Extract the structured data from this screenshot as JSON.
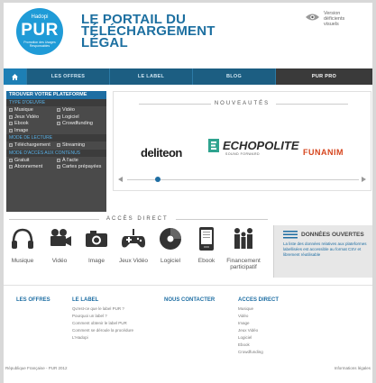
{
  "header": {
    "logo_small": "Hadopi",
    "logo_brand": "PUR",
    "logo_tagline": "Promotion des Usages Responsables",
    "title_line1": "LE PORTAIL DU",
    "title_line2": "TÉLÉCHARGEMENT",
    "title_line3": "LÉGAL",
    "accessibility_label": "Version déficients visuels"
  },
  "nav": {
    "items": [
      {
        "label": "LES OFFRES"
      },
      {
        "label": "LE LABEL"
      },
      {
        "label": "BLOG"
      },
      {
        "label": "PUR PRO"
      }
    ]
  },
  "platform_panel": {
    "title": "TROUVER VOTRE PLATEFORME",
    "section1": "TYPE D'OEUVRE",
    "types": [
      "Musique",
      "Vidéo",
      "Jeux Vidéo",
      "Logiciel",
      "Ebook",
      "Crowdfunding",
      "Image"
    ],
    "section2": "MODE DE LECTURE",
    "modes": [
      "Téléchargement",
      "Streaming"
    ],
    "section3": "MODE D'ACCÈS AUX CONTENUS",
    "access": [
      "Gratuit",
      "À l'acte",
      "Abonnement",
      "Cartes prépayées"
    ]
  },
  "news": {
    "title": "NOUVEAUTÉS",
    "partners": [
      "deliteon",
      "ECHOPOLITE",
      "FUNANIM"
    ],
    "echopolite_sub": "SOUND FORWARD"
  },
  "direct_access": {
    "title": "ACCÈS DIRECT",
    "tiles": [
      "Musique",
      "Vidéo",
      "Image",
      "Jeux Vidéo",
      "Logiciel",
      "Ebook",
      "Financement participatif"
    ]
  },
  "open_data": {
    "title": "DONNÉES OUVERTES",
    "text": "La liste des données relatives aux plateformes labellisées est accessible au format CSV et librement réutilisable"
  },
  "footer": {
    "col1": {
      "head": "LES OFFRES"
    },
    "col2": {
      "head": "LE LABEL",
      "links": [
        "Qu'est-ce que le label PUR ?",
        "Pourquoi un label ?",
        "Comment obtenir le label PUR",
        "Comment se déroule la procédure",
        "L'Hadopi"
      ]
    },
    "col3": {
      "head": "NOUS CONTACTER"
    },
    "col4": {
      "head": "ACCES DIRECT",
      "links": [
        "Musique",
        "Vidéo",
        "Image",
        "Jeux Vidéo",
        "Logiciel",
        "Ebook",
        "Crowdfunding"
      ]
    },
    "copyright": "République Française - PUR 2012",
    "legal": "Informations légales"
  },
  "colors": {
    "brand_blue": "#1f9bd7",
    "nav_blue": "#1c5e82",
    "title_blue": "#1c6fa0",
    "funanim_red": "#d6451d"
  }
}
